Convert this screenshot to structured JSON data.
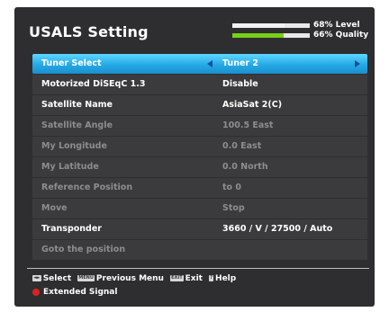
{
  "header": {
    "title": "USALS Setting",
    "level_text": "68% Level",
    "quality_text": "66% Quality",
    "level_value": 0.68,
    "quality_value": 0.66
  },
  "rows": [
    {
      "label": "Tuner Select",
      "value": "Tuner 2",
      "state": "selected"
    },
    {
      "label": "Motorized DiSEqC 1.3",
      "value": "Disable",
      "state": "enabled"
    },
    {
      "label": "Satellite Name",
      "value": "AsiaSat 2(C)",
      "state": "enabled"
    },
    {
      "label": "Satellite Angle",
      "value": "100.5 East",
      "state": "disabled"
    },
    {
      "label": "My Longitude",
      "value": "0.0 East",
      "state": "disabled"
    },
    {
      "label": "My Latitude",
      "value": "0.0 North",
      "state": "disabled"
    },
    {
      "label": "Reference Position",
      "value": "to 0",
      "state": "disabled"
    },
    {
      "label": "Move",
      "value": "Stop",
      "state": "disabled"
    },
    {
      "label": "Transponder",
      "value": "3660 / V / 27500 / Auto",
      "state": "enabled"
    },
    {
      "label": "Goto the position",
      "value": "",
      "state": "disabled"
    }
  ],
  "help": {
    "select_key": "◄►",
    "select_label": "Select",
    "menu_key": "MENU",
    "menu_label": "Previous Menu",
    "exit_key": "EXIT",
    "exit_label": "Exit",
    "help_key": "?",
    "help_label": "Help",
    "extended_label": "Extended Signal"
  },
  "colors": {
    "background": "#2e2e30",
    "selected_row": "#25a9e6",
    "quality_bar": "#78d018",
    "red_button": "#e02020"
  }
}
